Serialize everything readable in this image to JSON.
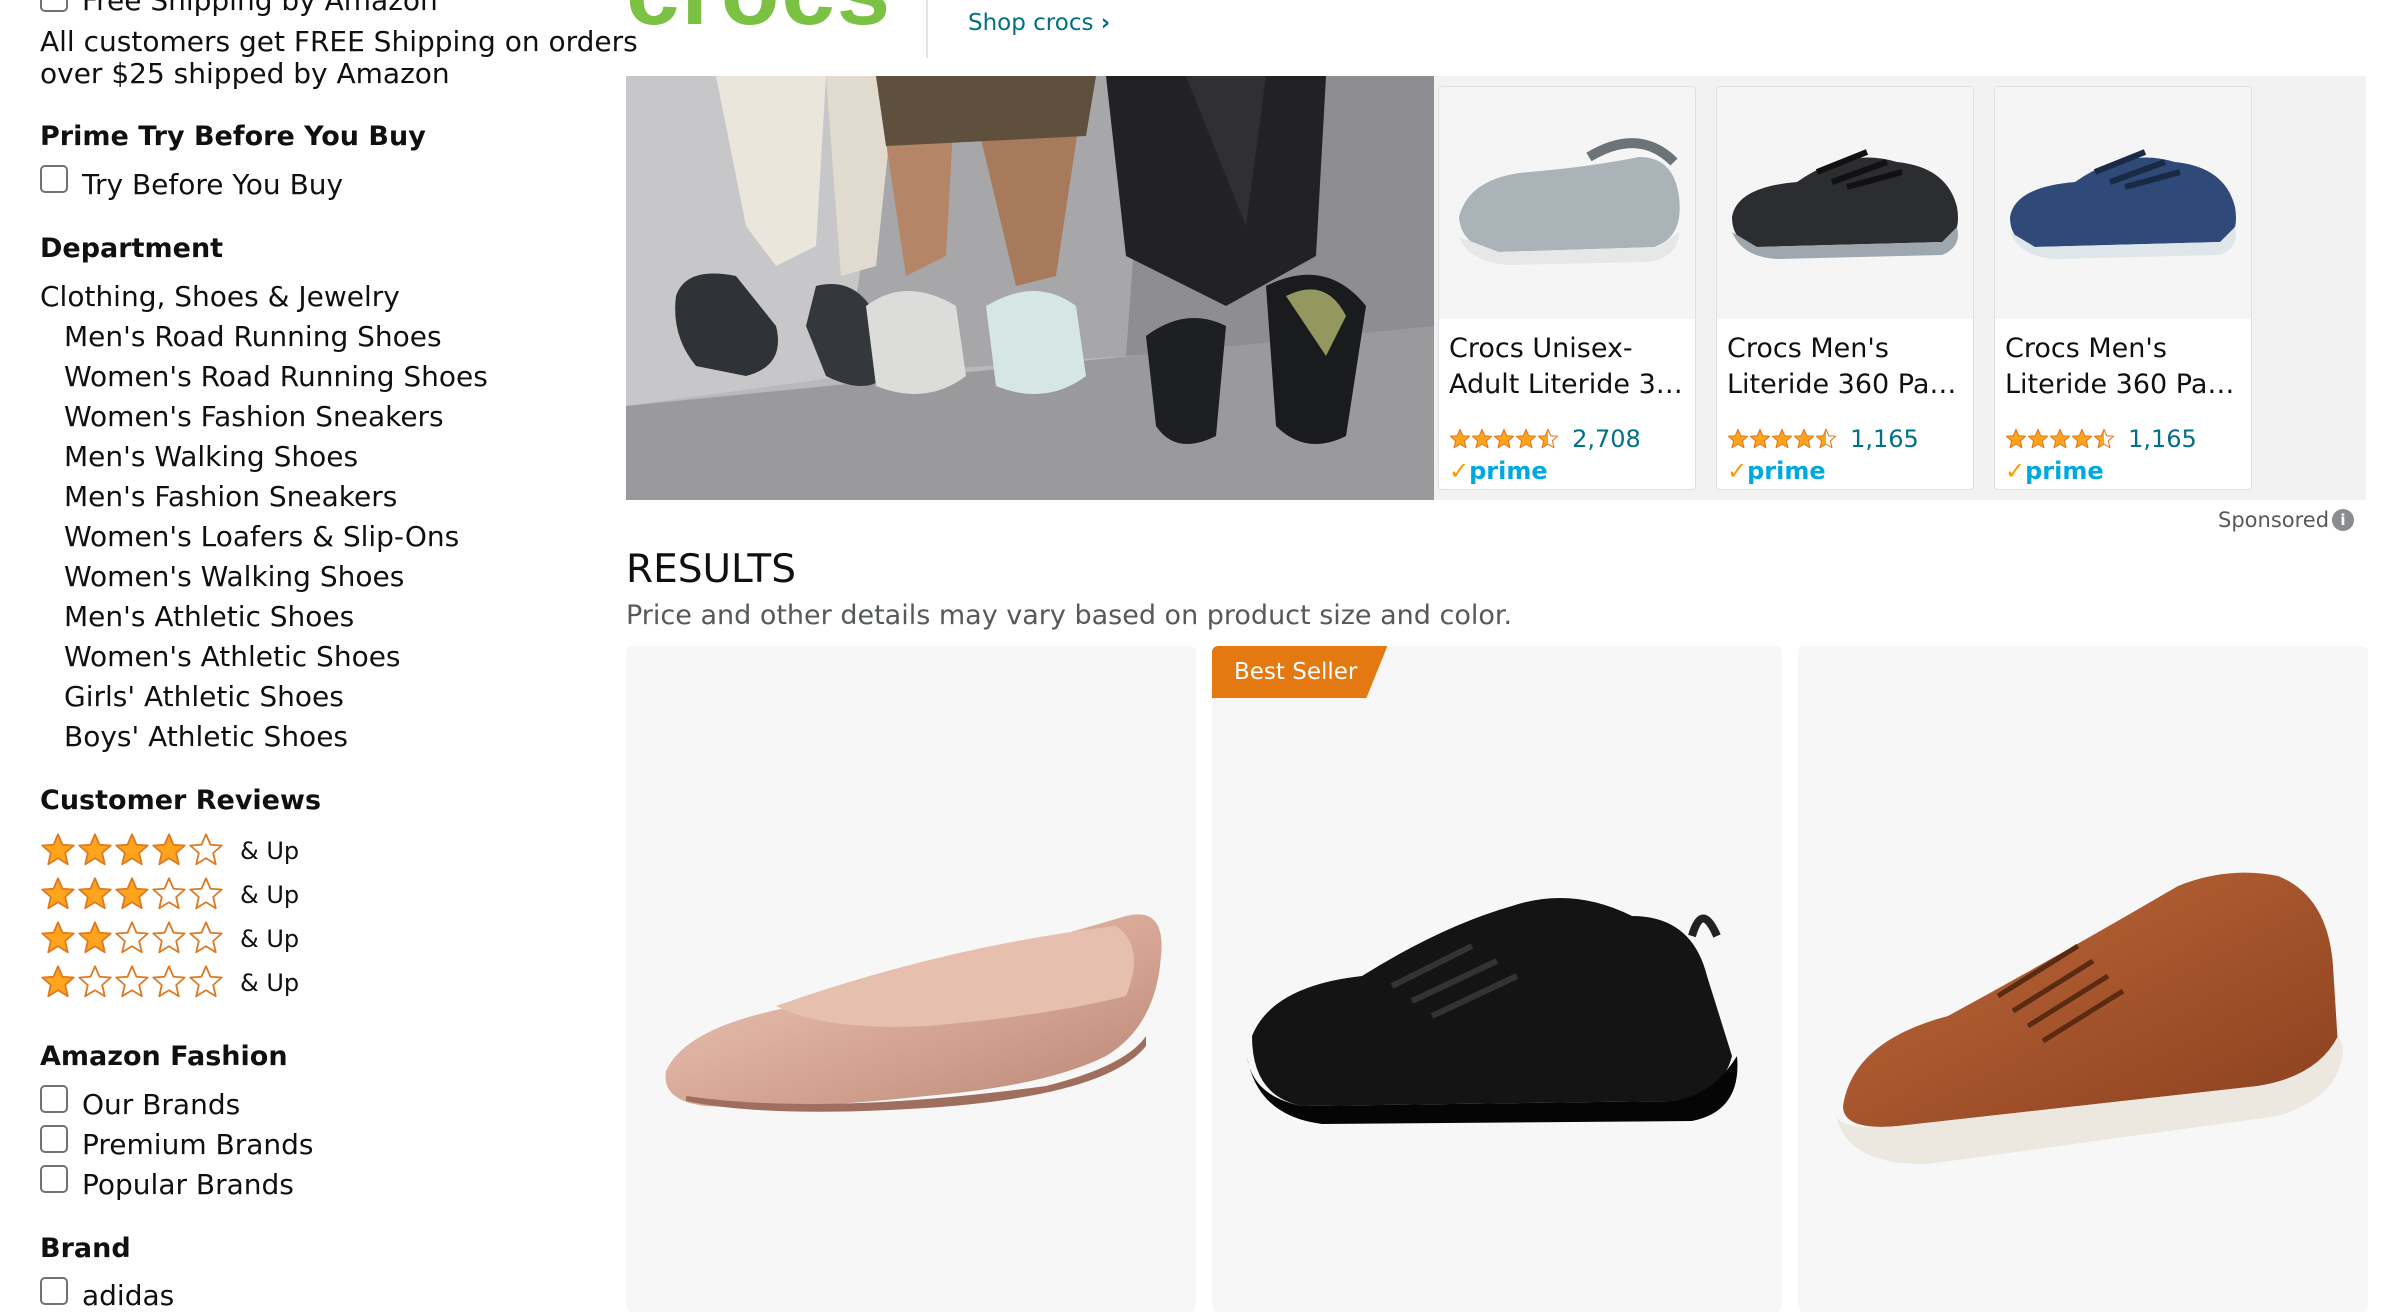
{
  "sidebar": {
    "free_shipping_label": "Free Shipping by Amazon",
    "free_shipping_note_line1": "All customers get FREE Shipping on orders",
    "free_shipping_note_line2": "over $25 shipped by Amazon",
    "prime_try_heading": "Prime Try Before You Buy",
    "prime_try_label": "Try Before You Buy",
    "department_heading": "Department",
    "department_root": "Clothing, Shoes & Jewelry",
    "department_items": [
      "Men's Road Running Shoes",
      "Women's Road Running Shoes",
      "Women's Fashion Sneakers",
      "Men's Walking Shoes",
      "Men's Fashion Sneakers",
      "Women's Loafers & Slip-Ons",
      "Women's Walking Shoes",
      "Men's Athletic Shoes",
      "Women's Athletic Shoes",
      "Girls' Athletic Shoes",
      "Boys' Athletic Shoes"
    ],
    "reviews_heading": "Customer Reviews",
    "review_filters": [
      {
        "stars": 4,
        "label": "& Up"
      },
      {
        "stars": 3,
        "label": "& Up"
      },
      {
        "stars": 2,
        "label": "& Up"
      },
      {
        "stars": 1,
        "label": "& Up"
      }
    ],
    "fashion_heading": "Amazon Fashion",
    "fashion_items": [
      "Our Brands",
      "Premium Brands",
      "Popular Brands"
    ],
    "brand_heading": "Brand",
    "brand_items": [
      "adidas"
    ]
  },
  "banner": {
    "brand_logo": "crocs",
    "shop_link": "Shop crocs",
    "shop_link_chevron": "›"
  },
  "sponsored_products": [
    {
      "title_line1": "Crocs Unisex-",
      "title_line2": "Adult Literide 3…",
      "rating": 4.5,
      "rating_count": "2,708",
      "prime": "prime",
      "color": "#a9b3b8"
    },
    {
      "title_line1": "Crocs Men's",
      "title_line2": "Literide 360 Pac…",
      "rating": 4.5,
      "rating_count": "1,165",
      "prime": "prime",
      "color": "#2b2d30"
    },
    {
      "title_line1": "Crocs Men's",
      "title_line2": "Literide 360 Pac…",
      "rating": 4.5,
      "rating_count": "1,165",
      "prime": "prime",
      "color": "#2f4a78"
    }
  ],
  "sponsored_label": "Sponsored",
  "sponsored_info_icon": "i",
  "results": {
    "title": "RESULTS",
    "subtitle": "Price and other details may vary based on product size and color.",
    "items": [
      {
        "badge": "",
        "image": "rose-gold-ballet-flat"
      },
      {
        "badge": "Best Seller",
        "image": "black-running-sneaker"
      },
      {
        "badge": "",
        "image": "brown-leather-sneaker"
      }
    ]
  },
  "colors": {
    "link": "#007185",
    "star": "#ffa41c",
    "prime": "#00a8e1",
    "best_seller": "#e47911",
    "brand_green": "#7bc143"
  }
}
